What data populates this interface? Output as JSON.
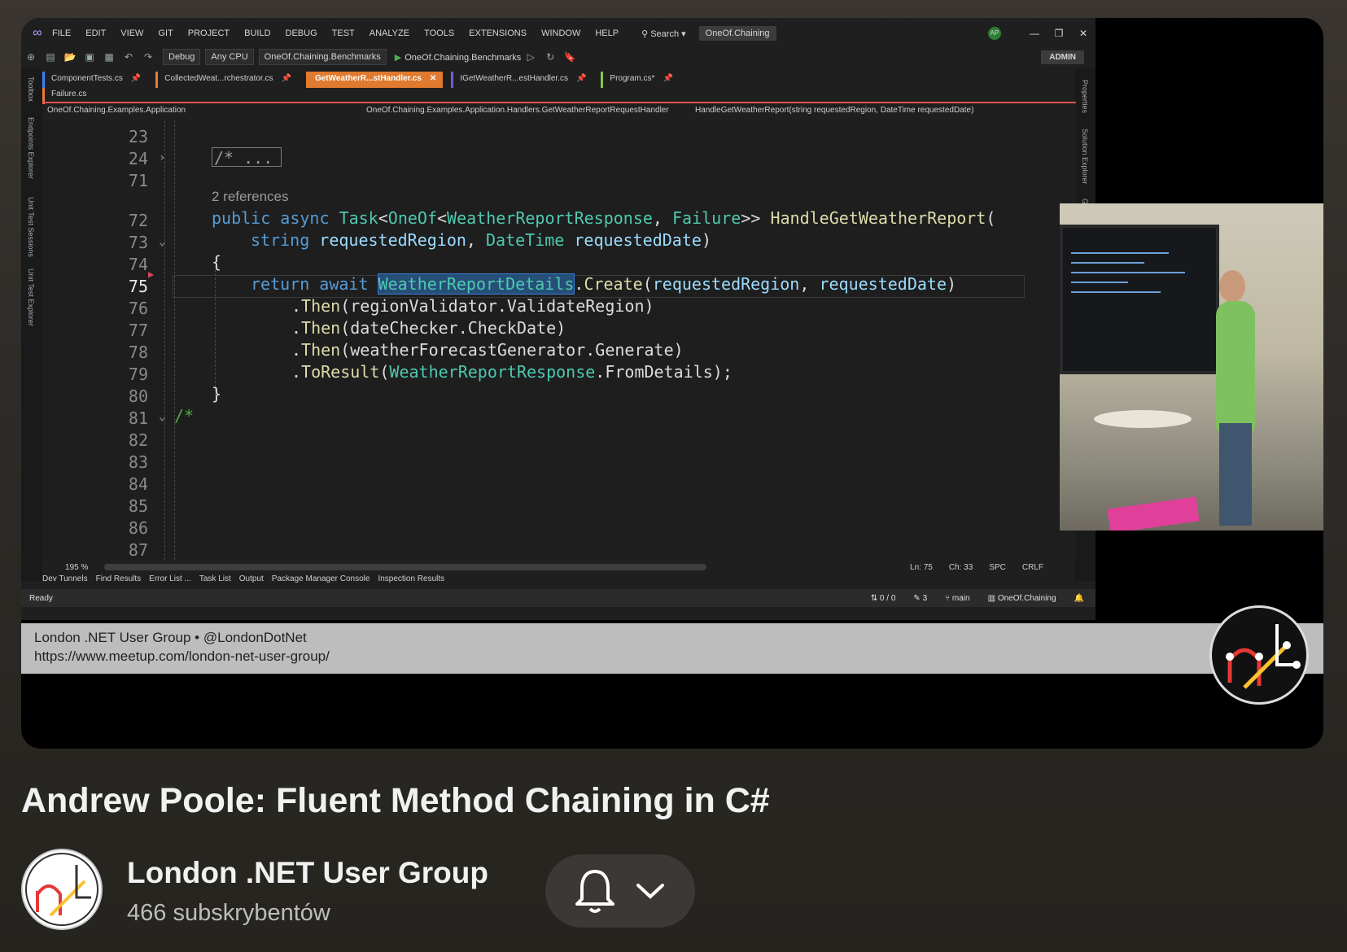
{
  "ide": {
    "menu": [
      "FILE",
      "EDIT",
      "VIEW",
      "GIT",
      "PROJECT",
      "BUILD",
      "DEBUG",
      "TEST",
      "ANALYZE",
      "TOOLS",
      "EXTENSIONS",
      "WINDOW",
      "HELP"
    ],
    "search_label": "Search",
    "solution_name": "OneOf.Chaining",
    "avatar_initials": "AP",
    "toolbar": {
      "config": "Debug",
      "platform": "Any CPU",
      "startup_project": "OneOf.Chaining.Benchmarks",
      "run_label": "OneOf.Chaining.Benchmarks",
      "admin": "ADMIN"
    },
    "tabs": [
      "ComponentTests.cs",
      "CollectedWeat...rchestrator.cs",
      "GetWeatherR...stHandler.cs",
      "IGetWeatherR...estHandler.cs",
      "Program.cs*"
    ],
    "tab_row2": "Failure.cs",
    "navbar": {
      "project": "OneOf.Chaining.Examples.Application",
      "class": "OneOf.Chaining.Examples.Application.Handlers.GetWeatherReportRequestHandler",
      "member": "HandleGetWeatherReport(string requestedRegion, DateTime requestedDate)"
    },
    "left_tools": [
      "Toolbox",
      "Endpoints Explorer",
      "Unit Test Sessions",
      "Unit Test Explorer"
    ],
    "right_tools": [
      "Properties",
      "Solution Explorer",
      "Git C"
    ],
    "line_numbers": [
      "23",
      "24",
      "71",
      "72",
      "73",
      "74",
      "75",
      "76",
      "77",
      "78",
      "79",
      "80",
      "81",
      "82",
      "83",
      "84",
      "85",
      "86",
      "87"
    ],
    "collapsed_region": "/* ...",
    "references": "2 references",
    "code": {
      "l72": {
        "kw1": "public",
        "kw2": "async",
        "t1": "Task",
        "p1": "<",
        "t2": "OneOf",
        "p2": "<",
        "t3": "WeatherReportResponse",
        "p3": ",",
        "t4": "Failure",
        "p4": ">>",
        "fn": "HandleGetWeatherReport",
        "p5": "("
      },
      "l73": {
        "kw": "string",
        "pa1": "requestedRegion",
        "p1": ",",
        "t": "DateTime",
        "pa2": "requestedDate",
        "p2": ")"
      },
      "l74": "{",
      "l75": {
        "kw1": "return",
        "kw2": "await",
        "hl": "WeatherReportDetails",
        "p1": ".",
        "fn": "Create",
        "p2": "(",
        "pa1": "requestedRegion",
        "p3": ",",
        "pa2": "requestedDate",
        "p4": ")"
      },
      "l76": {
        "p1": ".",
        "fn": "Then",
        "rest": "(regionValidator.ValidateRegion)"
      },
      "l77": {
        "p1": ".",
        "fn": "Then",
        "rest": "(dateChecker.CheckDate)"
      },
      "l78": {
        "p1": ".",
        "fn": "Then",
        "rest": "(weatherForecastGenerator.Generate)"
      },
      "l79": {
        "p1": ".",
        "fn": "ToResult",
        "p2": "(",
        "t": "WeatherReportResponse",
        "rest": ".FromDetails);"
      },
      "l80": "}",
      "l81": "/*"
    },
    "editor_status": {
      "zoom": "195 %",
      "ln": "Ln: 75",
      "ch": "Ch: 33",
      "spc": "SPC",
      "crlf": "CRLF"
    },
    "tool_windows": [
      "Dev Tunnels",
      "Find Results",
      "Error List ...",
      "Task List",
      "Output",
      "Package Manager Console",
      "Inspection Results"
    ],
    "status": {
      "ready": "Ready",
      "changes": "0 / 0",
      "edits": "3",
      "branch": "main",
      "repo": "OneOf.Chaining"
    }
  },
  "banner": {
    "line1": "London .NET User Group  •  @LondonDotNet",
    "line2": "https://www.meetup.com/london-net-user-group/"
  },
  "video": {
    "title": "Andrew Poole: Fluent Method Chaining in C#"
  },
  "channel": {
    "name": "London  .NET User Group",
    "subscribers": "466 subskrybentów"
  }
}
